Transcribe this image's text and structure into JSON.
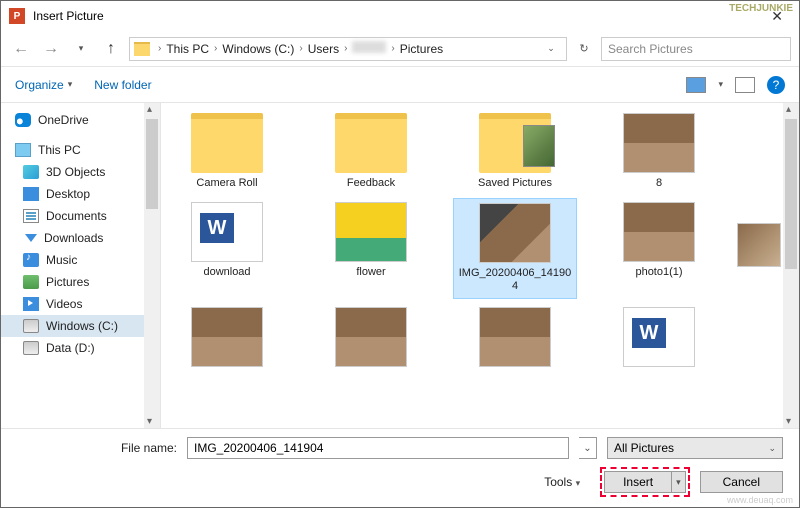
{
  "window": {
    "title": "Insert Picture",
    "app_icon": "P"
  },
  "nav": {
    "back_enabled": false,
    "breadcrumbs": [
      "This PC",
      "Windows (C:)",
      "Users",
      "",
      "Pictures"
    ],
    "search_placeholder": "Search Pictures"
  },
  "toolbar": {
    "organize": "Organize",
    "newfolder": "New folder"
  },
  "sidebar": {
    "onedrive": "OneDrive",
    "thispc": "This PC",
    "items": [
      "3D Objects",
      "Desktop",
      "Documents",
      "Downloads",
      "Music",
      "Pictures",
      "Videos",
      "Windows (C:)",
      "Data (D:)"
    ]
  },
  "files": {
    "row1": [
      "Camera Roll",
      "Feedback",
      "Saved Pictures",
      "8"
    ],
    "row2": [
      "download",
      "flower",
      "IMG_20200406_141904",
      "photo1(1)"
    ]
  },
  "footer": {
    "fname_label": "File name:",
    "fname_value": "IMG_20200406_141904",
    "filter": "All Pictures",
    "tools": "Tools",
    "insert": "Insert",
    "cancel": "Cancel"
  },
  "watermark": {
    "top": "TECHJUNKIE",
    "bottom": "www.deuaq.com"
  }
}
